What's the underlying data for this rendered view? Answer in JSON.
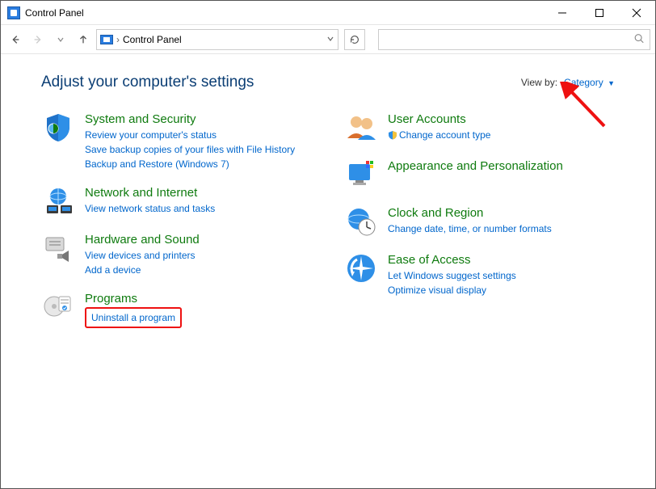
{
  "window": {
    "title": "Control Panel"
  },
  "address": {
    "location": "Control Panel"
  },
  "viewby": {
    "label": "View by:",
    "value": "Category"
  },
  "heading": "Adjust your computer's settings",
  "left": {
    "system": {
      "title": "System and Security",
      "link1": "Review your computer's status",
      "link2": "Save backup copies of your files with File History",
      "link3": "Backup and Restore (Windows 7)"
    },
    "network": {
      "title": "Network and Internet",
      "link1": "View network status and tasks"
    },
    "hardware": {
      "title": "Hardware and Sound",
      "link1": "View devices and printers",
      "link2": "Add a device"
    },
    "programs": {
      "title": "Programs",
      "link1": "Uninstall a program"
    }
  },
  "right": {
    "users": {
      "title": "User Accounts",
      "link1": "Change account type"
    },
    "appearance": {
      "title": "Appearance and Personalization"
    },
    "clock": {
      "title": "Clock and Region",
      "link1": "Change date, time, or number formats"
    },
    "ease": {
      "title": "Ease of Access",
      "link1": "Let Windows suggest settings",
      "link2": "Optimize visual display"
    }
  }
}
